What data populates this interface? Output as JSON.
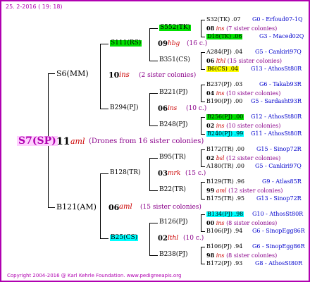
{
  "date": "25.  2-2016  ( 19: 18)",
  "footer": "Copyright 2004-2016 @ Karl Kehrle Foundation.   www.pedigreeapis.org",
  "root": {
    "label": "S7(SP)",
    "num": "11",
    "mark": "aml",
    "note": "(Drones from 16 sister colonies)"
  },
  "level1": [
    {
      "label": "S6(MM)",
      "num": "10",
      "mark": "ins",
      "note": "(2 sister colonies)"
    },
    {
      "label": "B121(AM)",
      "num": "06",
      "mark": "aml",
      "note": "(15 sister colonies)"
    }
  ],
  "level2": [
    {
      "label": "S111(RS)",
      "num": "09",
      "mark": "hbg",
      "note": "(16 c.)"
    },
    {
      "label": "B294(PJ)",
      "num": "06",
      "mark": "ins",
      "note": "(10 c.)"
    },
    {
      "label": "B128(TR)",
      "num": "03",
      "mark": "mrk",
      "note": "(15 c.)"
    },
    {
      "label": "B25(CS)",
      "num": "02",
      "mark": "lthl",
      "note": "(10 c.)"
    }
  ],
  "level3": [
    {
      "label": "S552(TK)",
      "num": "08",
      "mark": "ins",
      "note": "(7 sister colonies)"
    },
    {
      "label": "B351(CS)",
      "num": "06",
      "mark": "lthl",
      "note": "(15 sister colonies)"
    },
    {
      "label": "B221(PJ)",
      "num": "04",
      "mark": "ins",
      "note": "(10 sister colonies)"
    },
    {
      "label": "B248(PJ)",
      "num": "02",
      "mark": "ins",
      "note": "(10 sister colonies)"
    },
    {
      "label": "B95(TR)",
      "num": "02",
      "mark": "bsl",
      "note": "(12 sister colonies)"
    },
    {
      "label": "B22(TR)",
      "num": "99",
      "mark": "aml",
      "note": "(12 sister colonies)"
    },
    {
      "label": "B126(PJ)",
      "num": "00",
      "mark": "ins",
      "note": "(8 sister colonies)"
    },
    {
      "label": "B238(PJ)",
      "num": "98",
      "mark": "ins",
      "note": "(8 sister colonies)"
    }
  ],
  "level4": [
    {
      "label": "S32(TK)",
      "value": ".07",
      "info": "G0 - Erfoud07-1Q"
    },
    {
      "label": "D18(TK)",
      "value": ".06",
      "info": "G3 - Maced02Q"
    },
    {
      "label": "A284(PJ)",
      "value": ".04",
      "info": "G5 - Cankiri97Q"
    },
    {
      "label": "B6(CS)",
      "value": ".04",
      "info": "G13 - AthosSt80R"
    },
    {
      "label": "B237(PJ)",
      "value": ".03",
      "info": "G6 - Takab93R"
    },
    {
      "label": "B190(PJ)",
      "value": ".00",
      "info": "G5 - Sardasht93R"
    },
    {
      "label": "B256(PJ)",
      "value": ".00",
      "info": "G12 - AthosSt80R"
    },
    {
      "label": "B240(PJ)",
      "value": ".99",
      "info": "G11 - AthosSt80R"
    },
    {
      "label": "B172(TR)",
      "value": ".00",
      "info": "G15 - Sinop72R"
    },
    {
      "label": "A180(TR)",
      "value": ".00",
      "info": "G5 - Cankiri97Q"
    },
    {
      "label": "B129(TR)",
      "value": ".96",
      "info": "G9 - Atlas85R"
    },
    {
      "label": "B175(TR)",
      "value": ".95",
      "info": "G13 - Sinop72R"
    },
    {
      "label": "B134(PJ)",
      "value": ".98",
      "info": "G10 - AthosSt80R"
    },
    {
      "label": "B106(PJ)",
      "value": ".94",
      "info": "G6 - SinopEgg86R"
    },
    {
      "label": "B106(PJ)",
      "value": ".94",
      "info": "G6 - SinopEgg86R"
    },
    {
      "label": "B172(PJ)",
      "value": ".93",
      "info": "G8 - AthosSt80R"
    }
  ]
}
